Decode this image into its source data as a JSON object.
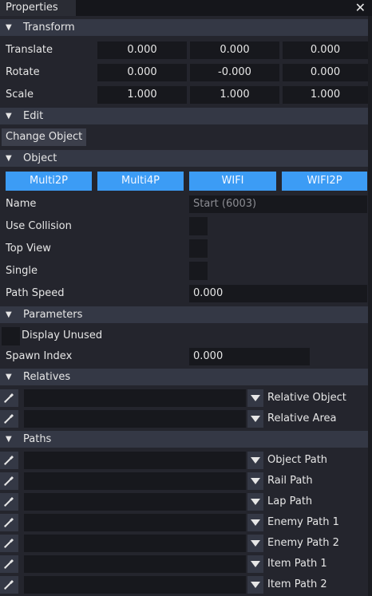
{
  "window": {
    "tab_title": "Properties",
    "close_glyph": "✕"
  },
  "sections": {
    "transform": "Transform",
    "edit": "Edit",
    "object": "Object",
    "parameters": "Parameters",
    "relatives": "Relatives",
    "paths": "Paths"
  },
  "transform": {
    "translate": {
      "label": "Translate",
      "x": "0.000",
      "y": "0.000",
      "z": "0.000"
    },
    "rotate": {
      "label": "Rotate",
      "x": "0.000",
      "y": "-0.000",
      "z": "0.000"
    },
    "scale": {
      "label": "Scale",
      "x": "1.000",
      "y": "1.000",
      "z": "1.000"
    }
  },
  "edit": {
    "change_object": "Change Object"
  },
  "object": {
    "buttons": [
      "Multi2P",
      "Multi4P",
      "WIFI",
      "WIFI2P"
    ],
    "name_label": "Name",
    "name_value": "Start (6003)",
    "use_collision": "Use Collision",
    "top_view": "Top View",
    "single": "Single",
    "path_speed_label": "Path Speed",
    "path_speed_value": "0.000"
  },
  "parameters": {
    "display_unused": "Display Unused",
    "spawn_index_label": "Spawn Index",
    "spawn_index_value": "0.000"
  },
  "relatives": [
    "Relative Object",
    "Relative Area"
  ],
  "paths": [
    "Object Path",
    "Rail Path",
    "Lap Path",
    "Enemy Path 1",
    "Enemy Path 2",
    "Item Path 1",
    "Item Path 2"
  ],
  "icons": {
    "section_toggle": "triangle-down-icon",
    "picker": "eyedropper-icon",
    "dropdown": "chevron-down-icon"
  },
  "colors": {
    "accent": "#3c9cf5",
    "header": "#343845",
    "field": "#17181d",
    "background": "#24252d"
  }
}
